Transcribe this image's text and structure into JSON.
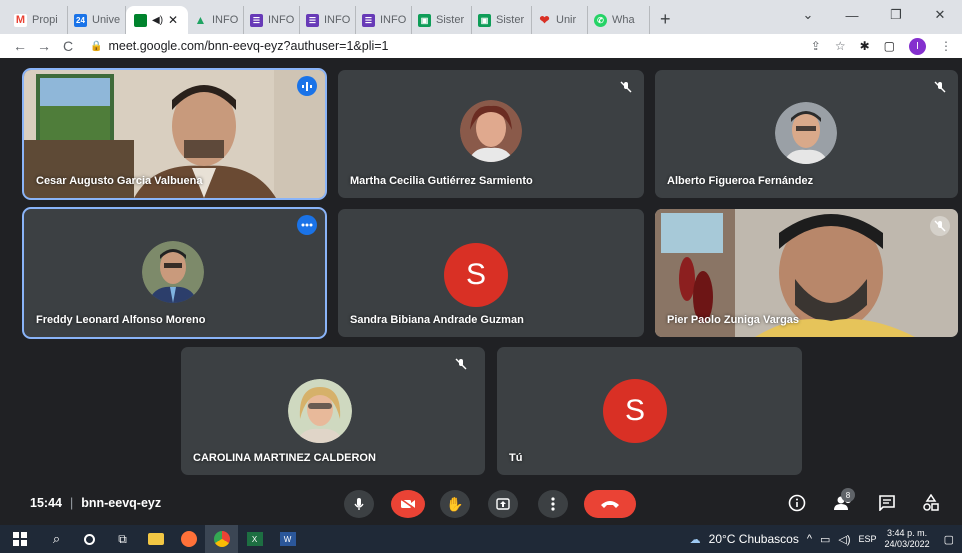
{
  "tabs": [
    {
      "label": "Propi",
      "icon": "gmail-icon",
      "color": "#ea4335"
    },
    {
      "label": "Unive",
      "icon": "calendar-icon",
      "color": "#1a73e8"
    },
    {
      "label": "",
      "icon": "meet-icon",
      "color": "#00832d",
      "active": true
    },
    {
      "label": "INFO",
      "icon": "drive-icon",
      "color": "#1fa463"
    },
    {
      "label": "INFO",
      "icon": "forms-icon",
      "color": "#673ab7"
    },
    {
      "label": "INFO",
      "icon": "forms-icon",
      "color": "#673ab7"
    },
    {
      "label": "INFO",
      "icon": "forms-icon",
      "color": "#673ab7"
    },
    {
      "label": "Sister",
      "icon": "classroom-icon",
      "color": "#0f9d58"
    },
    {
      "label": "Sister",
      "icon": "classroom-icon",
      "color": "#0f9d58"
    },
    {
      "label": "Unir",
      "icon": "heart-icon",
      "color": "#d93025"
    },
    {
      "label": "Wha",
      "icon": "whatsapp-icon",
      "color": "#25d366"
    }
  ],
  "address": {
    "url": "meet.google.com/bnn-eevq-eyz?authuser=1&pli=1",
    "profile_initial": "I"
  },
  "participants": [
    {
      "name": "Cesar Augusto Garcia Valbuena",
      "speaking": true
    },
    {
      "name": "Martha Cecilia Gutiérrez Sarmiento"
    },
    {
      "name": "Alberto Figueroa Fernández"
    },
    {
      "name": "Freddy Leonard Alfonso Moreno",
      "more": true
    },
    {
      "name": "Sandra Bibiana Andrade Guzman",
      "initial": "S"
    },
    {
      "name": "Pier Paolo Zuniga Vargas"
    },
    {
      "name": "CAROLINA MARTINEZ CALDERON"
    },
    {
      "name": "Tú",
      "initial": "S"
    }
  ],
  "meeting": {
    "time": "15:44",
    "separator": "|",
    "code": "bnn-eevq-eyz",
    "participant_count": "8"
  },
  "taskbar": {
    "weather": "20°C Chubascos",
    "lang": "ESP",
    "time": "3:44 p. m.",
    "date": "24/03/2022"
  },
  "colors": {
    "meet_bg": "#202124",
    "tile": "#3c4043",
    "accent": "#8ab4f8",
    "end_call": "#ea4335",
    "avatar_red": "#d93025"
  }
}
